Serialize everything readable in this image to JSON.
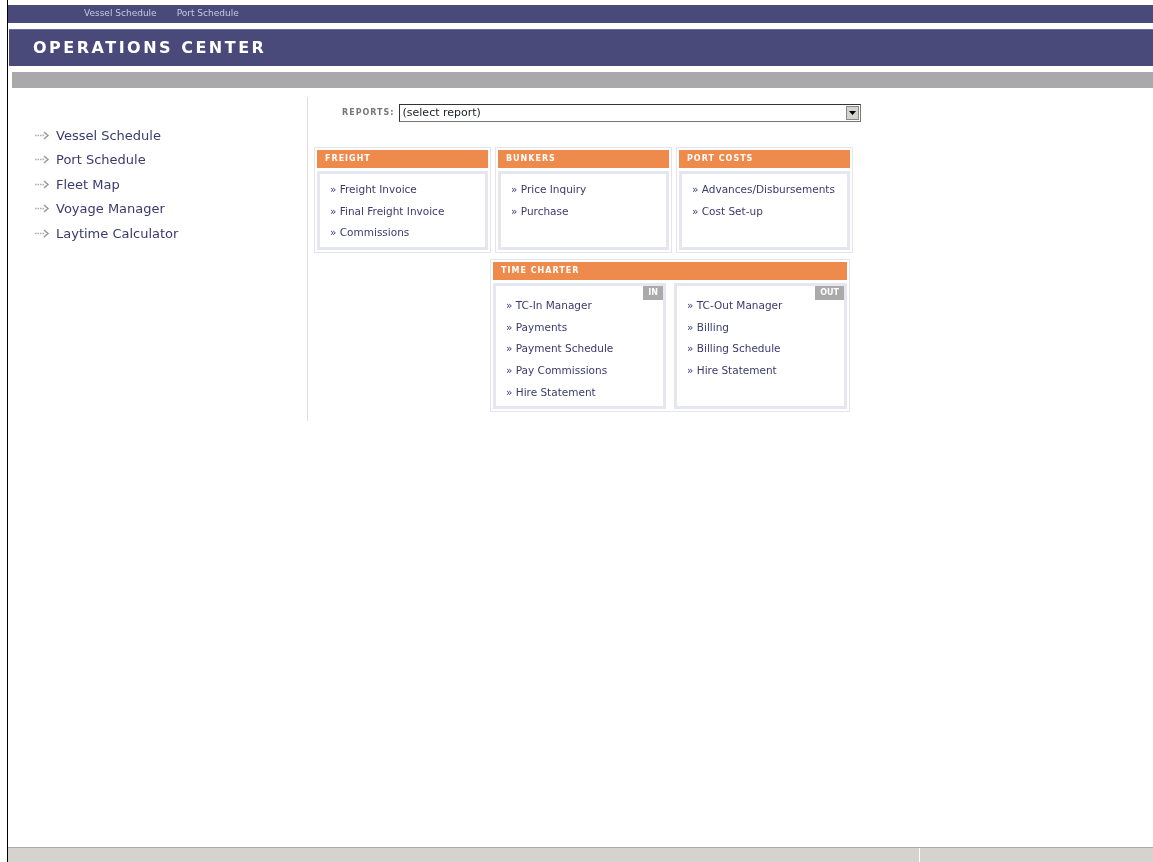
{
  "top_links": [
    "Vessel Schedule",
    "Port Schedule"
  ],
  "title": "OPERATIONS CENTER",
  "sidebar": {
    "items": [
      "Vessel Schedule",
      "Port Schedule",
      "Fleet Map",
      "Voyage Manager",
      "Laytime Calculator"
    ]
  },
  "reports": {
    "label": "REPORTS:",
    "value": "(select report)"
  },
  "panels": [
    {
      "title": "FREIGHT",
      "links": [
        "» Freight Invoice",
        "» Final Freight Invoice",
        "» Commissions"
      ]
    },
    {
      "title": "BUNKERS",
      "links": [
        "» Price Inquiry",
        "» Purchase"
      ]
    },
    {
      "title": "PORT COSTS",
      "links": [
        "» Advances/Disbursements",
        "» Cost Set-up"
      ]
    }
  ],
  "time_charter": {
    "title": "TIME CHARTER",
    "columns": [
      {
        "tag": "IN",
        "links": [
          "» TC-In Manager",
          "» Payments",
          "» Payment Schedule",
          "» Pay Commissions",
          "» Hire Statement"
        ]
      },
      {
        "tag": "OUT",
        "links": [
          "» TC-Out Manager",
          "» Billing",
          "» Billing Schedule",
          "» Hire Statement"
        ]
      }
    ]
  }
}
